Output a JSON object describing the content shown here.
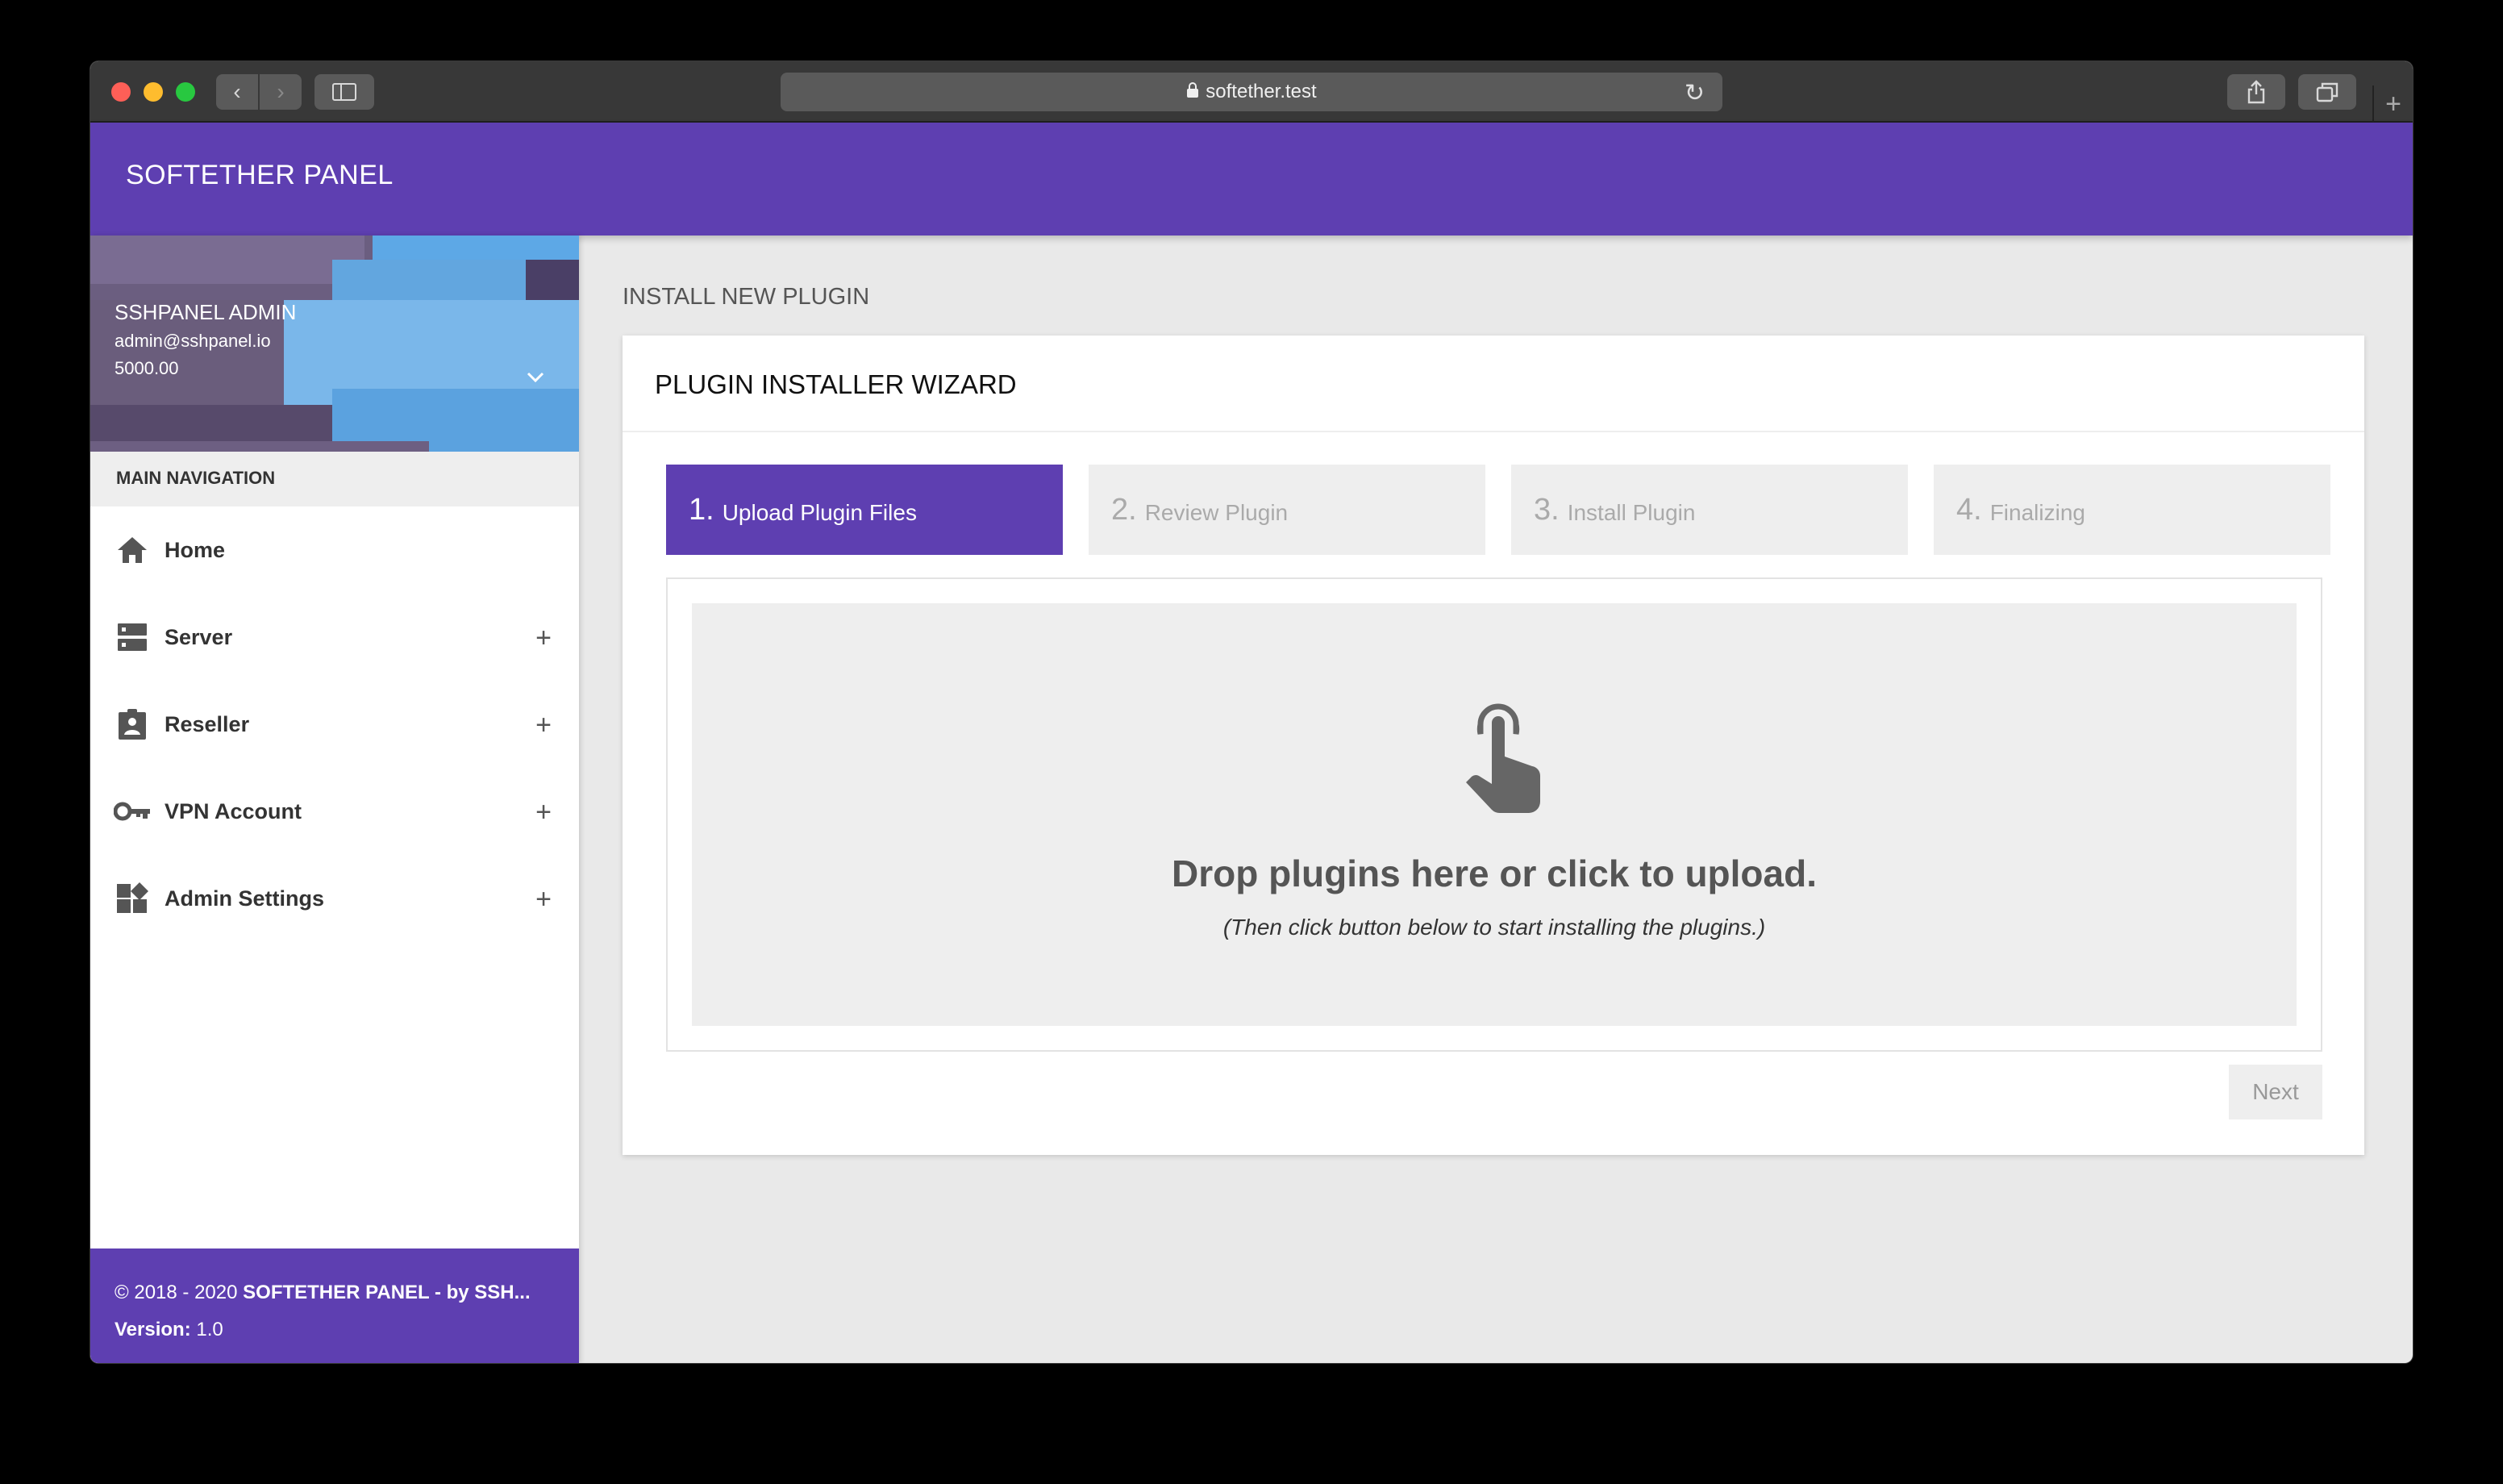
{
  "browser": {
    "url": "softether.test",
    "back_glyph": "‹",
    "forward_glyph": "›",
    "reload_glyph": "↻",
    "newtab_glyph": "+"
  },
  "app": {
    "brand": "SOFTETHER PANEL",
    "accent_color": "#5e3fb1"
  },
  "user": {
    "name": "SSHPANEL ADMIN",
    "email": "admin@sshpanel.io",
    "balance": "5000.00"
  },
  "sidebar": {
    "header": "MAIN NAVIGATION",
    "items": [
      {
        "label": "Home",
        "icon": "home-icon",
        "expandable": false
      },
      {
        "label": "Server",
        "icon": "server-icon",
        "expandable": true
      },
      {
        "label": "Reseller",
        "icon": "assignment-ind-icon",
        "expandable": true
      },
      {
        "label": "VPN Account",
        "icon": "key-icon",
        "expandable": true
      },
      {
        "label": "Admin Settings",
        "icon": "widgets-icon",
        "expandable": true
      }
    ],
    "expand_glyph": "+"
  },
  "footer": {
    "copyright_prefix": "© 2018 - 2020 ",
    "copyright_brand": "SOFTETHER PANEL - by SSH...",
    "version_label": "Version:",
    "version_value": " 1.0"
  },
  "page": {
    "title": "INSTALL NEW PLUGIN"
  },
  "wizard": {
    "title": "PLUGIN INSTALLER WIZARD",
    "steps": [
      {
        "number": "1.",
        "label": "Upload Plugin Files",
        "active": true
      },
      {
        "number": "2.",
        "label": "Review Plugin",
        "active": false
      },
      {
        "number": "3.",
        "label": "Install Plugin",
        "active": false
      },
      {
        "number": "4.",
        "label": "Finalizing",
        "active": false
      }
    ],
    "dropzone": {
      "icon": "touch-app-icon",
      "title": "Drop plugins here or click to upload.",
      "subtitle": "(Then click button below to start installing the plugins.)"
    },
    "next_label": "Next"
  }
}
